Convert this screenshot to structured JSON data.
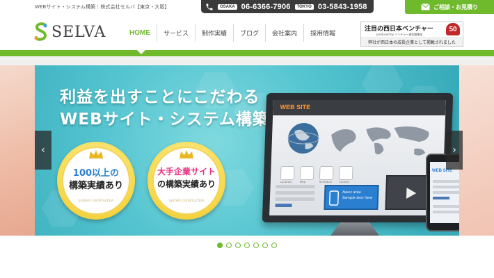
{
  "topbar": {
    "tagline": "WEBサイト・システム構築｜株式会社セルバ【東京・大阪】",
    "osaka_label": "OSAKA",
    "osaka_phone": "06-6366-7906",
    "tokyo_label": "TOKYO",
    "tokyo_phone": "03-5843-1958",
    "consult_label": "ご相談・お見積り"
  },
  "header": {
    "logo_text": "SELVA",
    "nav": [
      {
        "label": "HOME",
        "active": true
      },
      {
        "label": "サービス"
      },
      {
        "label": "制作実績"
      },
      {
        "label": "ブログ"
      },
      {
        "label": "会社案内"
      },
      {
        "label": "採用情報"
      }
    ],
    "venture": {
      "title": "注目の西日本ベンチャー",
      "number": "50",
      "sub": "produced by ベンチャー通信編集部",
      "note": "弊社が西日本の成長企業として掲載されました"
    }
  },
  "hero": {
    "line1": "利益を出すことにこだわる",
    "line2": "WEBサイト・システム構築",
    "medals": [
      {
        "a": "100以上の",
        "b": "構築実績あり",
        "c": "system construction",
        "accent": "#2a7fd1"
      },
      {
        "a": "大手企業サイト",
        "b": "の構築実績あり",
        "c": "system construction",
        "accent": "#e8307e"
      }
    ],
    "screen_logo": "WEB SITE",
    "screen_icons": [
      "Location",
      "Map",
      "Schedule",
      "Contact"
    ],
    "news_line1": "News area",
    "news_line2": "Sample text here",
    "phone_logo": "WEB SITE",
    "prev": "‹",
    "next": "›"
  },
  "slider": {
    "dot_count": 7,
    "active_index": 0
  },
  "colors": {
    "brand_green": "#6fb92c",
    "hero_teal": "#52c3cf",
    "dark": "#3b3b3b"
  }
}
